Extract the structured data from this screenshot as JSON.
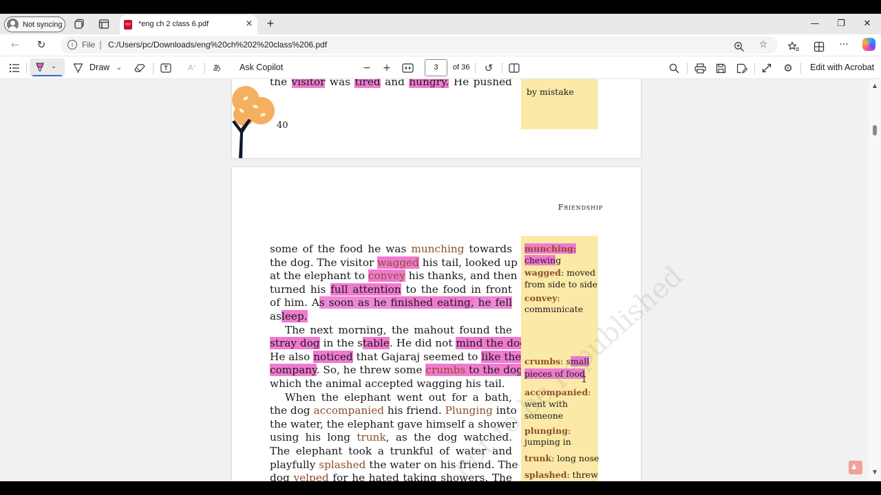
{
  "browser": {
    "profile_label": "Not syncing",
    "tab_title": "*eng ch 2 class 6.pdf",
    "tab_close": "×",
    "new_tab": "+",
    "window_controls": {
      "minimize": "—",
      "restore": "❐",
      "close": "✕"
    },
    "address": {
      "scheme": "File",
      "separator": "|",
      "url": "C:/Users/pc/Downloads/eng%20ch%202%20class%206.pdf"
    }
  },
  "pdf_toolbar": {
    "draw_label": "Draw",
    "ask_copilot_label": "Ask Copilot",
    "page_current": "3",
    "page_total": "of 36",
    "edit_acrobat_label": "Edit with Acrobat",
    "highlight_color": "#2f6fd6"
  },
  "page_prev": {
    "line": [
      "the",
      "visitor",
      "was",
      "tired",
      "and",
      "hungry.",
      "He pushed"
    ],
    "page_number": "40",
    "gloss_fragment": "by mistake"
  },
  "page_current": {
    "running_header": "Friendship",
    "body_lines": [
      [
        "some of the food he was ",
        "munching",
        " towards"
      ],
      [
        "the dog. The visitor ",
        "wagged",
        " his tail, looked up"
      ],
      [
        "at the elephant to ",
        "convey",
        " his thanks, and then"
      ],
      [
        "turned his ",
        "full attention",
        " to the food in front"
      ],
      [
        "of him. A",
        "s soon as he ",
        "finished eating,",
        " he fell"
      ],
      [
        "as",
        "leep."
      ],
      [
        "The next morning, the mahout found the"
      ],
      [
        "stray dog",
        " in the s",
        "table",
        ". He did not ",
        "mind the dog."
      ],
      [
        "He also ",
        "noticed",
        " that Gajaraj seemed to ",
        "like the"
      ],
      [
        "company",
        ". So, he threw some ",
        "crumbs",
        " to the dog,"
      ],
      [
        "which the animal accepted wagging his tail."
      ],
      [
        "When the elephant went out for a bath,"
      ],
      [
        "the dog ",
        "accompanied",
        " his friend. ",
        "Plunging",
        " into"
      ],
      [
        "the water, the elephant gave himself a shower"
      ],
      [
        "using his long ",
        "trunk",
        ", as the dog watched."
      ],
      [
        "The elephant took a trunkful of water and"
      ],
      [
        "playfully ",
        "splashed",
        " the water on his friend. The"
      ],
      [
        "dog ",
        "yelped",
        " for he hated taking showers. The"
      ]
    ],
    "glossary": [
      {
        "term": "munching",
        "def_parts": [
          ":",
          "chewin",
          "g"
        ]
      },
      {
        "term": "wagged",
        "def": ": moved",
        "def2": "from side to side"
      },
      {
        "term": "convey",
        "def": ":",
        "def2": "communicate"
      },
      {
        "term": "crumbs",
        "def": ": s",
        "def_hl": "mall",
        "def2": "pieces of food"
      },
      {
        "term": "accompanied",
        "def": ":",
        "def2": "went with",
        "def3": "someone"
      },
      {
        "term": "plunging",
        "def": ":",
        "def2": "jumping in"
      },
      {
        "term": "trunk",
        "def": ": long nose"
      },
      {
        "term": "splashed",
        "def": ": threw"
      }
    ],
    "watermark": "not to be republished"
  }
}
